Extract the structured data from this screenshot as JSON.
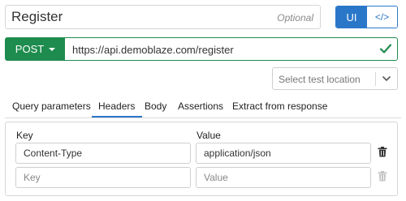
{
  "request": {
    "name": "Register",
    "name_hint": "Optional"
  },
  "mode_toggle": {
    "ui_label": "UI",
    "code_label": "</>"
  },
  "url_bar": {
    "method": "POST",
    "url": "https://api.demoblaze.com/register",
    "status_icon": "check-icon",
    "accent_color": "#1e8c4e"
  },
  "test_location": {
    "placeholder": "Select test location"
  },
  "tabs": [
    {
      "label": "Query parameters",
      "active": false
    },
    {
      "label": "Headers",
      "active": true
    },
    {
      "label": "Body",
      "active": false
    },
    {
      "label": "Assertions",
      "active": false
    },
    {
      "label": "Extract from response",
      "active": false
    }
  ],
  "headers_table": {
    "key_header": "Key",
    "value_header": "Value",
    "rows": [
      {
        "key": "Content-Type",
        "value": "application/json"
      }
    ],
    "empty_row": {
      "key_placeholder": "Key",
      "value_placeholder": "Value"
    }
  },
  "colors": {
    "primary": "#2a77c9",
    "success": "#1e8c4e"
  }
}
